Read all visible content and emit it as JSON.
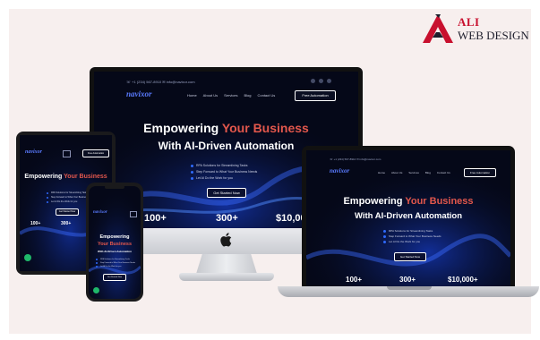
{
  "logo": {
    "line1": "ALI",
    "line2": "WEB DESIGN",
    "brand_color": "#c8102e"
  },
  "site": {
    "topbar_text": "☏ +1 (234) 567-8910   ✉ info@navixor.com",
    "brand": "navixor",
    "nav": [
      "Home",
      "About Us",
      "Services",
      "Blog",
      "Contact Us"
    ],
    "cta": "Free Automation",
    "hero_line1_pre": "Empowering ",
    "hero_line1_hl": "Your Business",
    "hero_line2": "With AI-Driven Automation",
    "features": [
      "RPA Solutions for Streamlining Tasks",
      "Step Forward to What Your Business Needs",
      "Let AI Do the Work for you"
    ],
    "start_button": "Get Started Now",
    "stats": [
      "100+",
      "300+",
      "$10,000+"
    ],
    "accent_color": "#e2574c"
  },
  "mobile": {
    "hero_a": "Empowering",
    "hero_b": "Your Business",
    "hero_c": "With AI-Driven Automation"
  }
}
